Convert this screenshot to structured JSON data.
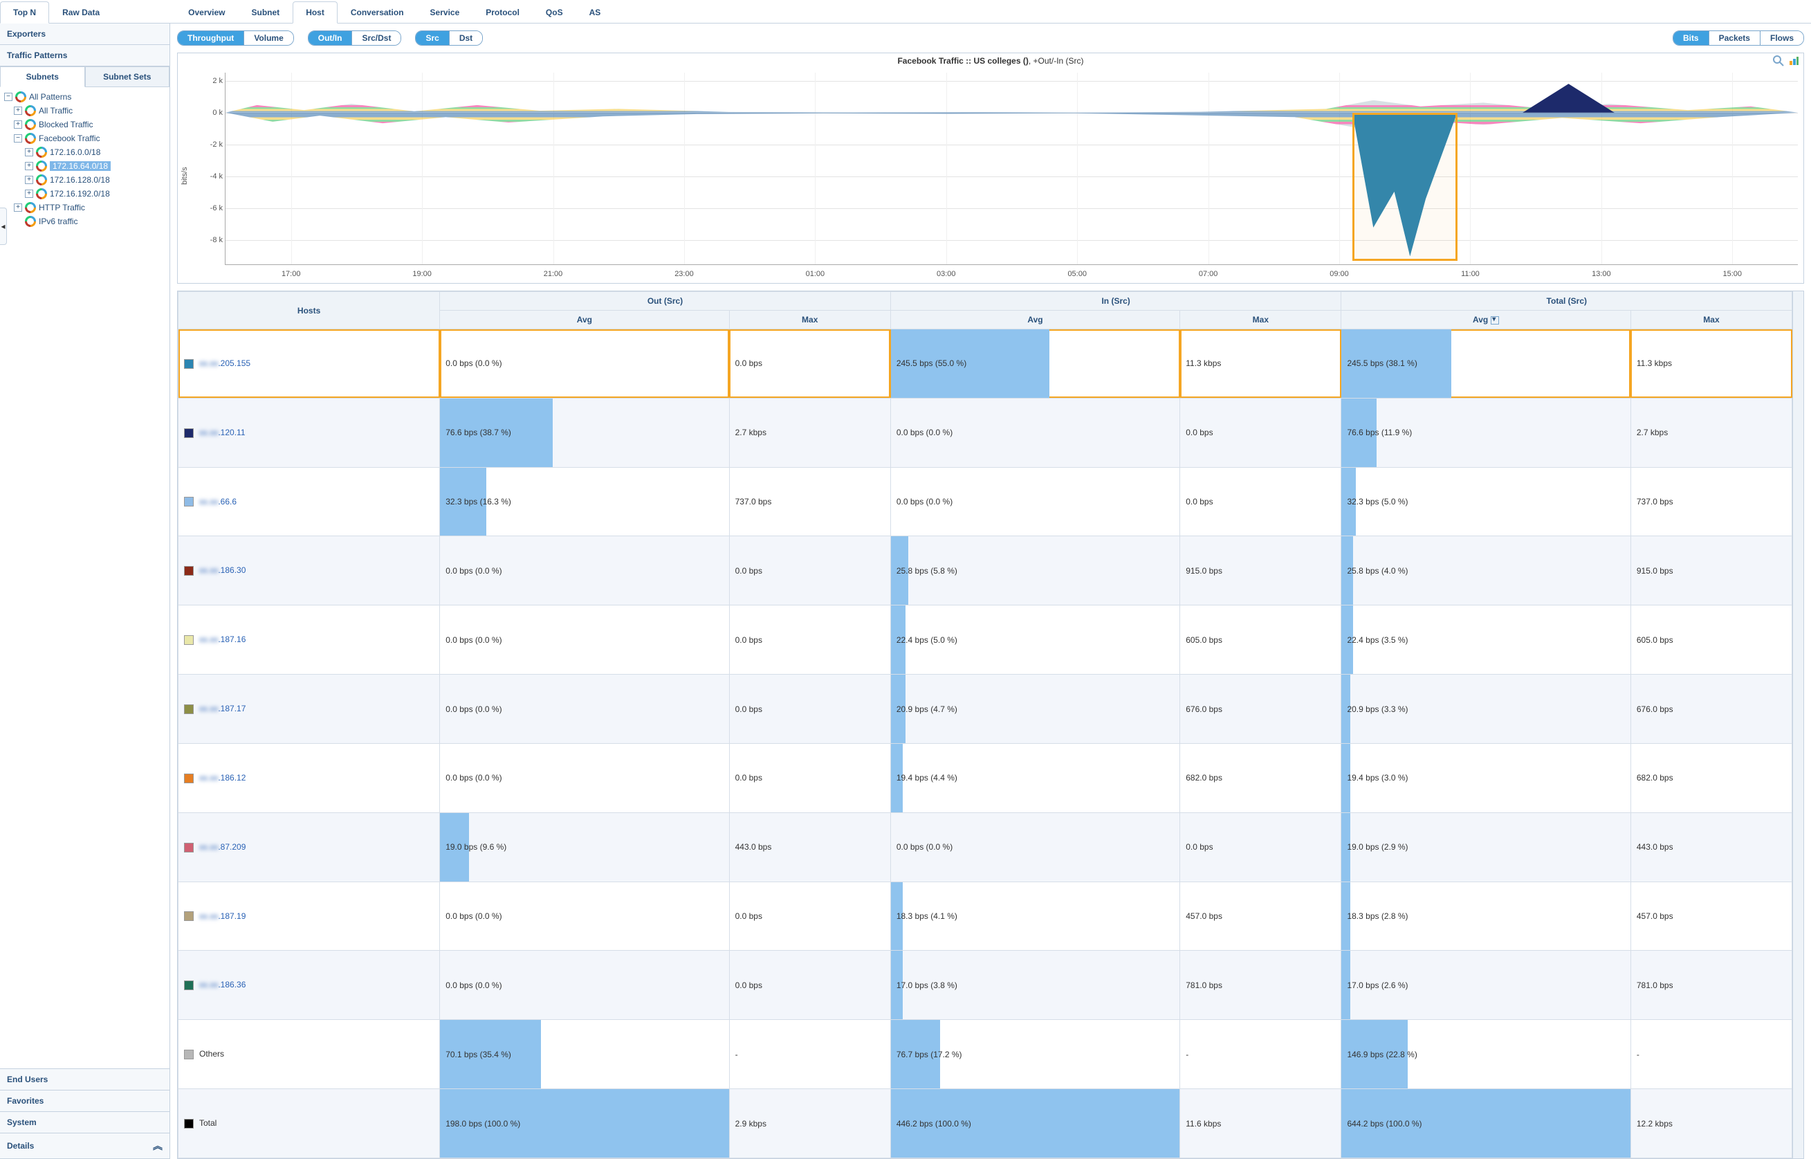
{
  "top_tabs": {
    "top_n": "Top N",
    "raw_data": "Raw Data",
    "overview": "Overview",
    "subnet": "Subnet",
    "host": "Host",
    "conversation": "Conversation",
    "service": "Service",
    "protocol": "Protocol",
    "qos": "QoS",
    "as": "AS",
    "active": "host"
  },
  "sidebar": {
    "exporters": "Exporters",
    "traffic_patterns": "Traffic Patterns",
    "sub_tabs": {
      "subnets": "Subnets",
      "subnet_sets": "Subnet Sets",
      "active": "subnets"
    },
    "tree": {
      "all_patterns": "All Patterns",
      "all_traffic": "All Traffic",
      "blocked_traffic": "Blocked Traffic",
      "facebook_traffic": "Facebook Traffic",
      "fb_children": [
        "172.16.0.0/18",
        "172.16.64.0/18",
        "172.16.128.0/18",
        "172.16.192.0/18"
      ],
      "selected": "172.16.64.0/18",
      "http_traffic": "HTTP Traffic",
      "ipv6_traffic": "IPv6 traffic"
    },
    "end_users": "End Users",
    "favorites": "Favorites",
    "system": "System",
    "details": "Details"
  },
  "filters": {
    "group1": {
      "throughput": "Throughput",
      "volume": "Volume",
      "active": "throughput"
    },
    "group2": {
      "outin": "Out/In",
      "srcdst": "Src/Dst",
      "active": "outin"
    },
    "group3": {
      "src": "Src",
      "dst": "Dst",
      "active": "src"
    },
    "group4": {
      "bits": "Bits",
      "packets": "Packets",
      "flows": "Flows",
      "active": "bits"
    }
  },
  "chart": {
    "title_bold": "Facebook Traffic :: US colleges ()",
    "title_rest": ", +Out/-In (Src)",
    "y_axis_label": "bits/s"
  },
  "chart_data": {
    "type": "area",
    "title": "Facebook Traffic :: US colleges (), +Out/-In (Src)",
    "ylabel": "bits/s",
    "xticks": [
      "17:00",
      "19:00",
      "21:00",
      "23:00",
      "01:00",
      "03:00",
      "05:00",
      "07:00",
      "09:00",
      "11:00",
      "13:00",
      "15:00"
    ],
    "yticks": [
      2000,
      0,
      -2000,
      -4000,
      -6000,
      -8000
    ],
    "ytick_labels": [
      "2 k",
      "0 k",
      "-2 k",
      "-4 k",
      "-6 k",
      "-8 k"
    ],
    "ylim": [
      -9500,
      2500
    ],
    "note": "stacked out(+)/in(-) area per host; values approximate from pixels",
    "highlight_window": {
      "start": "09:10",
      "end": "10:00"
    },
    "series": [
      {
        "name": "205.155",
        "color": "#2b85b2",
        "out": [
          100,
          80,
          60,
          40,
          20,
          10,
          5,
          5,
          5,
          5,
          5,
          5,
          5,
          5,
          5,
          10,
          20,
          40,
          80,
          200,
          60,
          40,
          30,
          20
        ],
        "in": [
          150,
          130,
          110,
          90,
          60,
          40,
          20,
          10,
          10,
          10,
          10,
          10,
          10,
          10,
          20,
          60,
          300,
          9000,
          200,
          80,
          60,
          40,
          30,
          30
        ]
      },
      {
        "name": "120.11",
        "color": "#1d2a6b",
        "out": [
          80,
          90,
          70,
          60,
          40,
          20,
          10,
          5,
          5,
          5,
          5,
          5,
          5,
          5,
          10,
          20,
          30,
          50,
          600,
          1800,
          100,
          60,
          40,
          30
        ],
        "in": [
          20,
          20,
          15,
          10,
          5,
          0,
          0,
          0,
          0,
          0,
          0,
          0,
          0,
          0,
          0,
          0,
          0,
          0,
          0,
          0,
          0,
          0,
          0,
          0
        ]
      },
      {
        "name": "Others",
        "color": "#9aa7ad",
        "out": [
          250,
          220,
          200,
          160,
          120,
          80,
          40,
          20,
          15,
          12,
          12,
          12,
          12,
          12,
          20,
          60,
          120,
          180,
          250,
          220,
          200,
          180,
          160,
          140
        ],
        "in": [
          260,
          230,
          210,
          170,
          130,
          90,
          50,
          25,
          18,
          15,
          15,
          15,
          15,
          15,
          25,
          70,
          140,
          200,
          260,
          230,
          210,
          190,
          170,
          150
        ]
      }
    ]
  },
  "table": {
    "group_headers": {
      "out": "Out (Src)",
      "in": "In (Src)",
      "total": "Total (Src)"
    },
    "col_headers": {
      "hosts": "Hosts",
      "avg": "Avg",
      "max": "Max"
    },
    "sort_col": "total_avg",
    "rows": [
      {
        "swatch": "#2b85b2",
        "host_blur": "xx.xx",
        "host": ".205.155",
        "out_avg": "0.0 bps (0.0 %)",
        "out_avg_bar": 0,
        "out_max": "0.0 bps",
        "in_avg": "245.5 bps (55.0 %)",
        "in_avg_bar": 55,
        "in_max": "11.3 kbps",
        "tot_avg": "245.5 bps (38.1 %)",
        "tot_avg_bar": 38,
        "tot_max": "11.3 kbps",
        "hl": true
      },
      {
        "swatch": "#1d2a6b",
        "host_blur": "xx.xx",
        "host": ".120.11",
        "out_avg": "76.6 bps (38.7 %)",
        "out_avg_bar": 39,
        "out_max": "2.7 kbps",
        "in_avg": "0.0 bps (0.0 %)",
        "in_avg_bar": 0,
        "in_max": "0.0 bps",
        "tot_avg": "76.6 bps (11.9 %)",
        "tot_avg_bar": 12,
        "tot_max": "2.7 kbps"
      },
      {
        "swatch": "#8fbbe6",
        "host_blur": "xx.xx",
        "host": ".66.6",
        "out_avg": "32.3 bps (16.3 %)",
        "out_avg_bar": 16,
        "out_max": "737.0 bps",
        "in_avg": "0.0 bps (0.0 %)",
        "in_avg_bar": 0,
        "in_max": "0.0 bps",
        "tot_avg": "32.3 bps (5.0 %)",
        "tot_avg_bar": 5,
        "tot_max": "737.0 bps"
      },
      {
        "swatch": "#8c2a18",
        "host_blur": "xx.xx",
        "host": ".186.30",
        "out_avg": "0.0 bps (0.0 %)",
        "out_avg_bar": 0,
        "out_max": "0.0 bps",
        "in_avg": "25.8 bps (5.8 %)",
        "in_avg_bar": 6,
        "in_max": "915.0 bps",
        "tot_avg": "25.8 bps (4.0 %)",
        "tot_avg_bar": 4,
        "tot_max": "915.0 bps"
      },
      {
        "swatch": "#e9e7a9",
        "host_blur": "xx.xx",
        "host": ".187.16",
        "out_avg": "0.0 bps (0.0 %)",
        "out_avg_bar": 0,
        "out_max": "0.0 bps",
        "in_avg": "22.4 bps (5.0 %)",
        "in_avg_bar": 5,
        "in_max": "605.0 bps",
        "tot_avg": "22.4 bps (3.5 %)",
        "tot_avg_bar": 4,
        "tot_max": "605.0 bps"
      },
      {
        "swatch": "#8d8f46",
        "host_blur": "xx.xx",
        "host": ".187.17",
        "out_avg": "0.0 bps (0.0 %)",
        "out_avg_bar": 0,
        "out_max": "0.0 bps",
        "in_avg": "20.9 bps (4.7 %)",
        "in_avg_bar": 5,
        "in_max": "676.0 bps",
        "tot_avg": "20.9 bps (3.3 %)",
        "tot_avg_bar": 3,
        "tot_max": "676.0 bps"
      },
      {
        "swatch": "#e67e22",
        "host_blur": "xx.xx",
        "host": ".186.12",
        "out_avg": "0.0 bps (0.0 %)",
        "out_avg_bar": 0,
        "out_max": "0.0 bps",
        "in_avg": "19.4 bps (4.4 %)",
        "in_avg_bar": 4,
        "in_max": "682.0 bps",
        "tot_avg": "19.4 bps (3.0 %)",
        "tot_avg_bar": 3,
        "tot_max": "682.0 bps"
      },
      {
        "swatch": "#d06072",
        "host_blur": "xx.xx",
        "host": ".87.209",
        "out_avg": "19.0 bps (9.6 %)",
        "out_avg_bar": 10,
        "out_max": "443.0 bps",
        "in_avg": "0.0 bps (0.0 %)",
        "in_avg_bar": 0,
        "in_max": "0.0 bps",
        "tot_avg": "19.0 bps (2.9 %)",
        "tot_avg_bar": 3,
        "tot_max": "443.0 bps"
      },
      {
        "swatch": "#b3a17b",
        "host_blur": "xx.xx",
        "host": ".187.19",
        "out_avg": "0.0 bps (0.0 %)",
        "out_avg_bar": 0,
        "out_max": "0.0 bps",
        "in_avg": "18.3 bps (4.1 %)",
        "in_avg_bar": 4,
        "in_max": "457.0 bps",
        "tot_avg": "18.3 bps (2.8 %)",
        "tot_avg_bar": 3,
        "tot_max": "457.0 bps"
      },
      {
        "swatch": "#1f6f56",
        "host_blur": "xx.xx",
        "host": ".186.36",
        "out_avg": "0.0 bps (0.0 %)",
        "out_avg_bar": 0,
        "out_max": "0.0 bps",
        "in_avg": "17.0 bps (3.8 %)",
        "in_avg_bar": 4,
        "in_max": "781.0 bps",
        "tot_avg": "17.0 bps (2.6 %)",
        "tot_avg_bar": 3,
        "tot_max": "781.0 bps"
      },
      {
        "swatch": "#b7b7b7",
        "host_blur": "",
        "host": "Others",
        "out_avg": "70.1 bps (35.4 %)",
        "out_avg_bar": 35,
        "out_max": "-",
        "in_avg": "76.7 bps (17.2 %)",
        "in_avg_bar": 17,
        "in_max": "-",
        "tot_avg": "146.9 bps (22.8 %)",
        "tot_avg_bar": 23,
        "tot_max": "-",
        "plain": true
      },
      {
        "swatch": "#000000",
        "host_blur": "",
        "host": "Total",
        "out_avg": "198.0 bps (100.0 %)",
        "out_avg_bar": 100,
        "out_max": "2.9 kbps",
        "in_avg": "446.2 bps (100.0 %)",
        "in_avg_bar": 100,
        "in_max": "11.6 kbps",
        "tot_avg": "644.2 bps (100.0 %)",
        "tot_avg_bar": 100,
        "tot_max": "12.2 kbps",
        "plain": true
      }
    ]
  }
}
